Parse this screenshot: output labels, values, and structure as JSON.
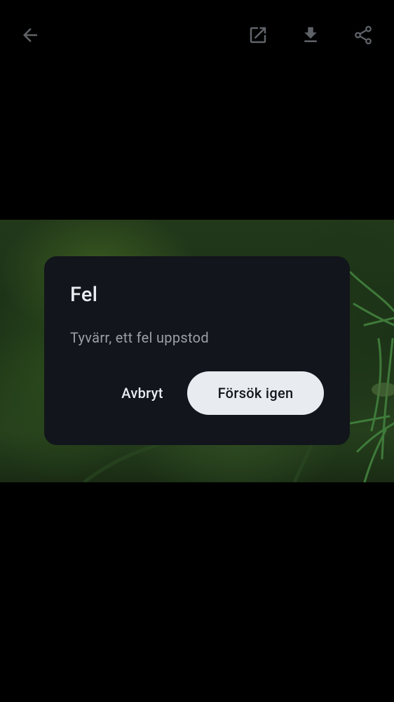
{
  "toolbar": {
    "icons": {
      "back": "arrow-back-icon",
      "open_external": "open-in-new-icon",
      "download": "download-icon",
      "share": "share-icon"
    },
    "icon_color": "#5f6368"
  },
  "dialog": {
    "title": "Fel",
    "message": "Tyvärr, ett fel uppstod",
    "cancel_label": "Avbryt",
    "retry_label": "Försök igen",
    "background": "#12151b",
    "primary_button_color": "#e8ebf0"
  }
}
